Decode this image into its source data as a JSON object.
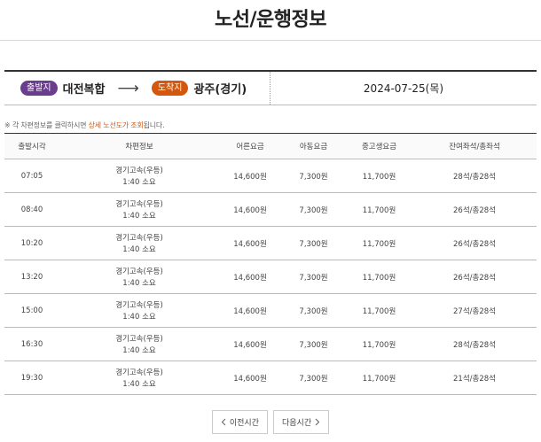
{
  "page_title": "노선/운행정보",
  "route": {
    "departure_badge": "출발지",
    "departure": "대전복합",
    "arrow": "⟶",
    "arrival_badge": "도착지",
    "arrival": "광주(경기)",
    "date": "2024-07-25(목)"
  },
  "notice": {
    "prefix": "※ 각 차편정보를 클릭하시면 ",
    "highlight": "상세 노선도가 조회",
    "suffix": "됩니다."
  },
  "table": {
    "headers": {
      "time": "출발시각",
      "info": "차편정보",
      "adult": "어른요금",
      "child": "아동요금",
      "student": "중고생요금",
      "seats": "잔여좌석/총좌석"
    },
    "rows": [
      {
        "time": "07:05",
        "company": "경기고속(우등)",
        "duration": "1:40 소요",
        "adult": "14,600원",
        "child": "7,300원",
        "student": "11,700원",
        "seats": "28석/총28석"
      },
      {
        "time": "08:40",
        "company": "경기고속(우등)",
        "duration": "1:40 소요",
        "adult": "14,600원",
        "child": "7,300원",
        "student": "11,700원",
        "seats": "26석/총28석"
      },
      {
        "time": "10:20",
        "company": "경기고속(우등)",
        "duration": "1:40 소요",
        "adult": "14,600원",
        "child": "7,300원",
        "student": "11,700원",
        "seats": "26석/총28석"
      },
      {
        "time": "13:20",
        "company": "경기고속(우등)",
        "duration": "1:40 소요",
        "adult": "14,600원",
        "child": "7,300원",
        "student": "11,700원",
        "seats": "26석/총28석"
      },
      {
        "time": "15:00",
        "company": "경기고속(우등)",
        "duration": "1:40 소요",
        "adult": "14,600원",
        "child": "7,300원",
        "student": "11,700원",
        "seats": "27석/총28석"
      },
      {
        "time": "16:30",
        "company": "경기고속(우등)",
        "duration": "1:40 소요",
        "adult": "14,600원",
        "child": "7,300원",
        "student": "11,700원",
        "seats": "28석/총28석"
      },
      {
        "time": "19:30",
        "company": "경기고속(우등)",
        "duration": "1:40 소요",
        "adult": "14,600원",
        "child": "7,300원",
        "student": "11,700원",
        "seats": "21석/총28석"
      }
    ]
  },
  "pager": {
    "prev_icon": "chevron-left-icon",
    "prev_label": "이전시간",
    "next_label": "다음시간",
    "next_icon": "chevron-right-icon"
  },
  "colors": {
    "departure_badge": "#6b3d8f",
    "arrival_badge": "#d4570e",
    "highlight": "#d4570e"
  }
}
